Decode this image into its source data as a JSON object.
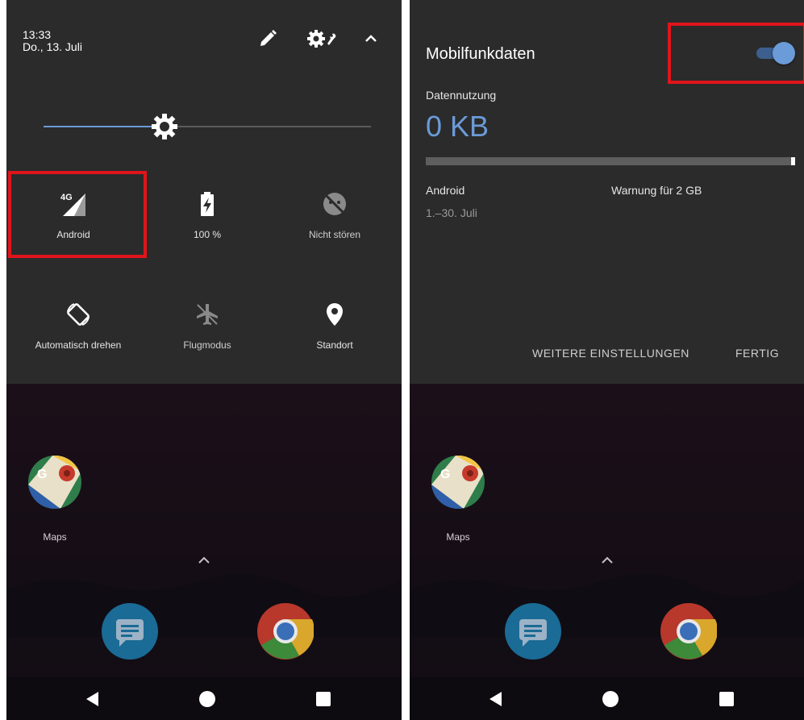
{
  "left": {
    "time": "13:33",
    "date": "Do., 13. Juli",
    "brightness_level": 0.37,
    "tiles": [
      {
        "label": "Android",
        "icon": "signal-4g-icon",
        "network_badge": "4G"
      },
      {
        "label": "100 %",
        "icon": "battery-charging-icon"
      },
      {
        "label": "Nicht stören",
        "icon": "do-not-disturb-icon"
      },
      {
        "label": "Automatisch drehen",
        "icon": "auto-rotate-icon"
      },
      {
        "label": "Flugmodus",
        "icon": "airplane-icon"
      },
      {
        "label": "Standort",
        "icon": "location-icon"
      }
    ]
  },
  "right": {
    "title": "Mobilfunkdaten",
    "toggle_on": true,
    "usage_label": "Datennutzung",
    "usage_value": "0 KB",
    "usage_fraction": 0.0,
    "carrier": "Android",
    "period": "1.–30. Juli",
    "warning": "Warnung für 2 GB",
    "more_settings": "WEITERE EINSTELLUNGEN",
    "done": "FERTIG"
  },
  "home": {
    "maps_label": "Maps"
  },
  "colors": {
    "accent": "#6b9bd8",
    "panel": "#2b2b2b",
    "highlight": "#e0141b"
  }
}
